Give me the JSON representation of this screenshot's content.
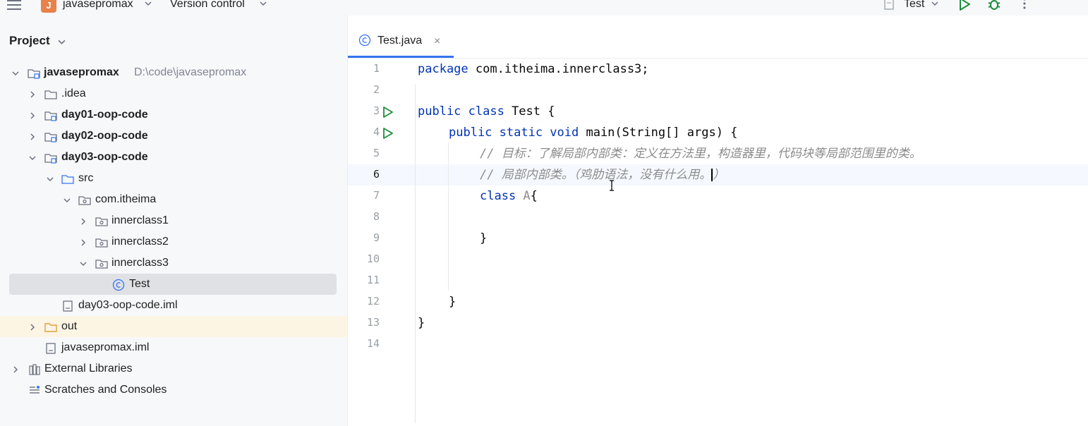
{
  "toolbar": {
    "project_badge": "J",
    "project_name": "javasepromax",
    "vcs_label": "Version control",
    "run_config": "Test",
    "icons": [
      "hamburger-menu-icon",
      "run-icon",
      "debug-icon",
      "more-vertical-icon"
    ],
    "colors": {
      "badge": "#e8814a",
      "run": "#1e8e3e",
      "accent": "#3574f0"
    }
  },
  "project_panel": {
    "title": "Project",
    "tree": [
      {
        "label": "javasepromax",
        "path": "D:\\code\\javasepromax",
        "bold": true,
        "expanded": true,
        "icon": "module-folder-icon",
        "depth": 0
      },
      {
        "label": ".idea",
        "expanded": false,
        "icon": "folder-icon",
        "depth": 1
      },
      {
        "label": "day01-oop-code",
        "bold": true,
        "expanded": false,
        "icon": "module-folder-icon",
        "depth": 1
      },
      {
        "label": "day02-oop-code",
        "bold": true,
        "expanded": false,
        "icon": "module-folder-icon",
        "depth": 1
      },
      {
        "label": "day03-oop-code",
        "bold": true,
        "expanded": true,
        "icon": "module-folder-icon",
        "depth": 1
      },
      {
        "label": "src",
        "expanded": true,
        "icon": "source-folder-icon",
        "depth": 2
      },
      {
        "label": "com.itheima",
        "expanded": true,
        "icon": "package-icon",
        "depth": 3
      },
      {
        "label": "innerclass1",
        "expanded": false,
        "icon": "package-icon",
        "depth": 4
      },
      {
        "label": "innerclass2",
        "expanded": false,
        "icon": "package-icon",
        "depth": 4
      },
      {
        "label": "innerclass3",
        "expanded": true,
        "icon": "package-icon",
        "depth": 4
      },
      {
        "label": "Test",
        "icon": "java-class-icon",
        "depth": 5,
        "selected": true
      },
      {
        "label": "day03-oop-code.iml",
        "icon": "iml-file-icon",
        "depth": 2
      },
      {
        "label": "out",
        "expanded": false,
        "icon": "excluded-folder-icon",
        "depth": 1
      },
      {
        "label": "javasepromax.iml",
        "icon": "iml-file-icon",
        "depth": 1
      },
      {
        "label": "External Libraries",
        "expanded": false,
        "icon": "libraries-icon",
        "depth": 0
      },
      {
        "label": "Scratches and Consoles",
        "icon": "scratches-icon",
        "depth": 0
      }
    ]
  },
  "editor": {
    "tab_label": "Test.java",
    "tab_close": "×",
    "current_line": 6,
    "line_numbers": [
      "1",
      "2",
      "3",
      "4",
      "5",
      "6",
      "7",
      "8",
      "9",
      "10",
      "11",
      "12",
      "13",
      "14"
    ],
    "lines": {
      "l1_kw": "package",
      "l1_rest": " com.itheima.innerclass3;",
      "l3_kw": "public class",
      "l3_rest": " Test {",
      "l4_kw": "public static void",
      "l4_rest": " main(String[] args) {",
      "l5": "// 目标：了解局部内部类：定义在方法里，构造器里，代码块等局部范围里的类。",
      "l6a": "// 局部内部类。（鸡肋语法，没有什么用。",
      "l6b": "）",
      "l7_kw": "class",
      "l7_name": " A",
      "l7_rest": "{",
      "l9": "}",
      "l12": "}",
      "l13": "}"
    }
  }
}
